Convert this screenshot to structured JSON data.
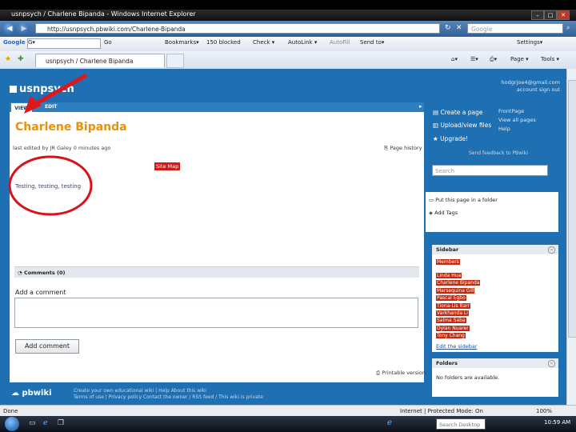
{
  "browser": {
    "window_title": "usnpsych / Charlene Bipanda - Windows Internet Explorer",
    "url": "http://usnpsych.pbwiki.com/Charlene-Bipanda",
    "search_placeholder": "Google",
    "tab_title": "usnpsych / Charlene Bipanda",
    "google_toolbar": {
      "logo": "Google",
      "search_value": "G▾",
      "go": "Go",
      "bookmarks": "Bookmarks▾",
      "blocked": "150 blocked",
      "check": "Check ▾",
      "autolink": "AutoLink ▾",
      "autofill": "AutoFill",
      "sendto": "Send to▾",
      "settings": "Settings▾"
    },
    "commands": {
      "page": "Page ▾",
      "tools": "Tools ▾"
    },
    "status": {
      "left": "Done",
      "zone": "Internet | Protected Mode: On",
      "zoom": "100%"
    }
  },
  "site": {
    "logo": "usnpsych",
    "user_name": "hodgrjoe4@gmail.com",
    "user_links": "account  sign out",
    "tabs": {
      "view": "VIEW",
      "edit": "EDIT"
    },
    "page_title": "Charlene Bipanda",
    "last_edited": "last edited by  JR Galey   0 minutes ago",
    "page_history": "Page history",
    "site_map": "Site Map",
    "body_text": "Testing, testing, testing",
    "comments_header": "Comments (0)",
    "add_comment_label": "Add a comment",
    "add_comment_button": "Add comment",
    "printable": "Printable version",
    "sidebar_actions": {
      "create_page": "Create a page",
      "upload": "Upload/view files",
      "upgrade": "Upgrade!",
      "frontpage": "FrontPage",
      "view_all_pages": "View all pages",
      "help": "Help",
      "send_feedback": "Send feedback to PBwiki",
      "search_placeholder": "Search"
    },
    "page_actions": {
      "put_in_folder": "Put this page in a folder",
      "add_tags": "Add Tags"
    },
    "sidebar": {
      "title": "Sidebar",
      "members_label": "Members",
      "members": [
        "Linda Hua",
        "Charlene Bipanda",
        "Marsequina Gill",
        "Pascal Egbo",
        "Tiona-Lis Barr",
        "Varkhanda Li",
        "Salma Saba",
        "Dylan Nuarer",
        "Tony Chang"
      ],
      "edit_link": "Edit the sidebar"
    },
    "folders": {
      "title": "Folders",
      "empty": "No folders are available."
    },
    "footer": {
      "logo": "pbwiki",
      "line1": "Create your own educational wiki  |  Help           About this wiki",
      "line2": "Terms of use  |  Privacy policy                   Contact the owner / RSS feed / This wiki is private"
    }
  },
  "taskbar": {
    "search": "Search Desktop",
    "time": "10:59 AM"
  },
  "colors": {
    "wiki_blue": "#1f6fb3",
    "title_orange": "#e8920c",
    "annotation_red": "#e0161b"
  }
}
